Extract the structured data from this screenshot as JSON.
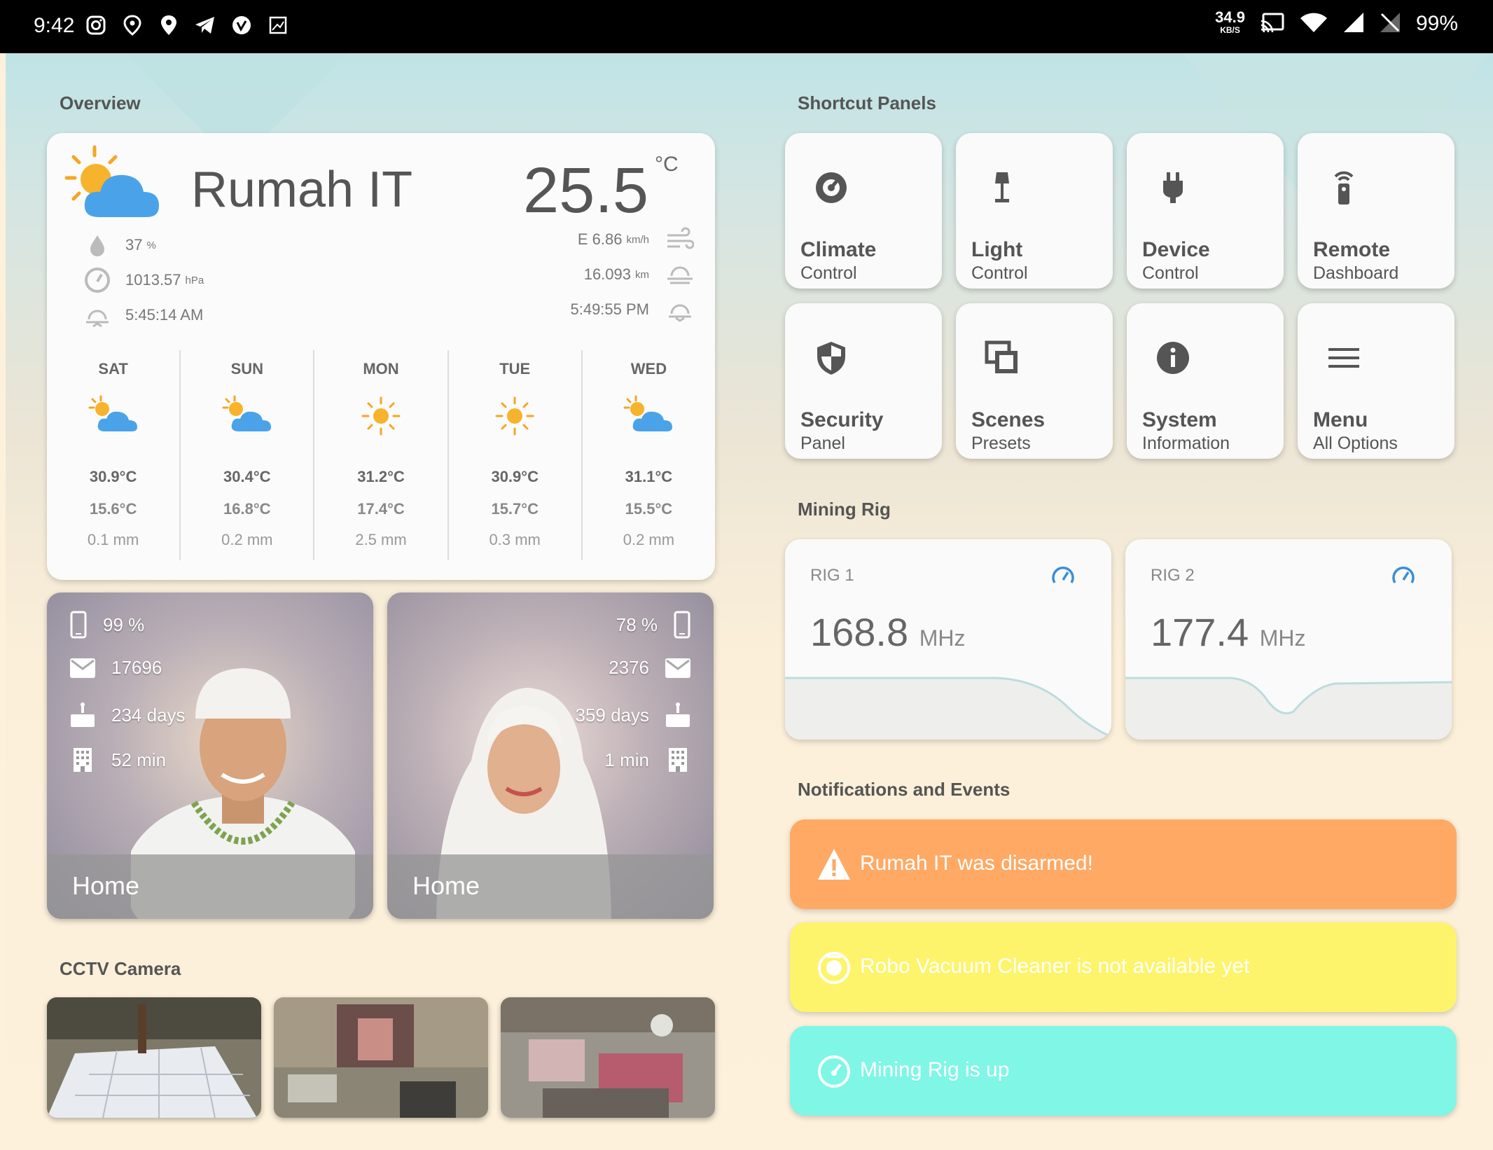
{
  "status_bar": {
    "time": "9:42",
    "icons": [
      "instagram-icon",
      "location-pin-outline-icon",
      "location-pin-icon",
      "telegram-icon",
      "vimeo-icon",
      "image-icon"
    ],
    "net_speed": "34.9",
    "net_unit": "KB/S",
    "battery": "99%"
  },
  "overview": {
    "title": "Overview",
    "weather": {
      "location": "Rumah IT",
      "temperature": "25.5",
      "unit": "°C",
      "humidity": "37",
      "humidity_unit": "%",
      "pressure": "1013.57",
      "pressure_unit": "hPa",
      "sunrise": "5:45:14 AM",
      "wind": "E 6.86",
      "wind_unit": "km/h",
      "visibility": "16.093",
      "visibility_unit": "km",
      "sunset": "5:49:55 PM"
    },
    "forecast": [
      {
        "day": "SAT",
        "icon": "partly-cloudy-icon",
        "high": "30.9°C",
        "low": "15.6°C",
        "rain": "0.1 mm"
      },
      {
        "day": "SUN",
        "icon": "partly-cloudy-icon",
        "high": "30.4°C",
        "low": "16.8°C",
        "rain": "0.2 mm"
      },
      {
        "day": "MON",
        "icon": "sunny-icon",
        "high": "31.2°C",
        "low": "17.4°C",
        "rain": "2.5 mm"
      },
      {
        "day": "TUE",
        "icon": "sunny-icon",
        "high": "30.9°C",
        "low": "15.7°C",
        "rain": "0.3 mm"
      },
      {
        "day": "WED",
        "icon": "partly-cloudy-icon",
        "high": "31.1°C",
        "low": "15.5°C",
        "rain": "0.2 mm"
      }
    ]
  },
  "persons": [
    {
      "battery": "99 %",
      "messages": "17696",
      "age": "234 days",
      "commute": "52 min",
      "location": "Home"
    },
    {
      "battery": "78 %",
      "messages": "2376",
      "age": "359 days",
      "commute": "1 min",
      "location": "Home"
    }
  ],
  "cctv": {
    "title": "CCTV Camera",
    "cameras": [
      "cctv-camera-1",
      "cctv-camera-2",
      "cctv-camera-3"
    ]
  },
  "shortcuts": {
    "title": "Shortcut Panels",
    "tiles": [
      {
        "title": "Climate",
        "subtitle": "Control",
        "icon": "climate-icon"
      },
      {
        "title": "Light",
        "subtitle": "Control",
        "icon": "lamp-icon"
      },
      {
        "title": "Device",
        "subtitle": "Control",
        "icon": "plug-icon"
      },
      {
        "title": "Remote",
        "subtitle": "Dashboard",
        "icon": "remote-icon"
      },
      {
        "title": "Security",
        "subtitle": "Panel",
        "icon": "shield-icon"
      },
      {
        "title": "Scenes",
        "subtitle": "Presets",
        "icon": "scenes-icon"
      },
      {
        "title": "System",
        "subtitle": "Information",
        "icon": "info-icon"
      },
      {
        "title": "Menu",
        "subtitle": "All Options",
        "icon": "menu-icon"
      }
    ]
  },
  "mining": {
    "title": "Mining Rig",
    "rigs": [
      {
        "label": "RIG 1",
        "value": "168.8",
        "unit": "MHz"
      },
      {
        "label": "RIG 2",
        "value": "177.4",
        "unit": "MHz"
      }
    ]
  },
  "notifications": {
    "title": "Notifications and Events",
    "items": [
      {
        "text": "Rumah IT was disarmed!",
        "color": "#ffa964",
        "icon": "warning-icon"
      },
      {
        "text": "Robo Vacuum Cleaner is not available yet",
        "color": "#fdf46c",
        "icon": "vacuum-icon"
      },
      {
        "text": "Mining Rig is up",
        "color": "#7ff6e6",
        "icon": "gauge-icon"
      }
    ]
  }
}
